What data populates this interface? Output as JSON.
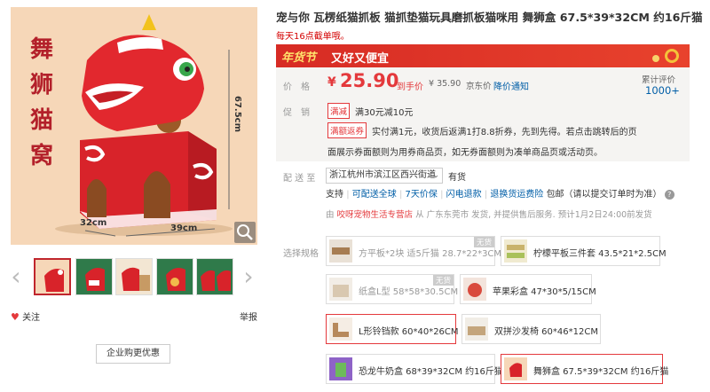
{
  "product": {
    "title": "宠与你 瓦楞纸猫抓板 猫抓垫猫玩具磨抓板猫咪用 舞狮盒 67.5*39*32CM 约16斤猫",
    "ship_note": "每天16点截单哦。"
  },
  "gallery": {
    "main_caption": "舞狮猫窝",
    "dim_height": "67.5cm",
    "dim_depth": "32cm",
    "dim_width": "39cm",
    "follow_label": "关注",
    "report_label": "举报",
    "corp_button": "企业购更优惠"
  },
  "banner": {
    "logo": "年货节",
    "slogan": "又好又便宜"
  },
  "price": {
    "label": "价　格",
    "currency": "¥",
    "value": "25.90",
    "suffix": "到手价",
    "jd_price": "¥ 35.90",
    "jd_label": "京东价",
    "notify": "降价通知",
    "review_label": "累计评价",
    "review_count": "1000+"
  },
  "promo": {
    "label": "促　销",
    "tag1": "满减",
    "text1": "满30元减10元",
    "tag2": "满额返券",
    "text2": "实付满1元，收货后返满1打8.8折券，先到先得。若点击跳转后的页",
    "text3": "面展示券面额则为用券商品页，如无券面额则为凑单商品页或活动页。"
  },
  "delivery": {
    "label": "配 送 至",
    "address": "浙江杭州市滨江区西兴街道",
    "stock": "有货",
    "support_label": "支持",
    "services": [
      "可配送全球",
      "7天价保",
      "闪电退款",
      "退换货运费险",
      "包邮（请以提交订单时为准）"
    ],
    "seller_prefix": "由",
    "seller": "咬呀宠物生活专营店",
    "seller_suffix": "从 广东东莞市 发货, 并提供售后服务. 预计1月2日24:00前发货"
  },
  "variants": {
    "label": "选择规格",
    "no_stock": "无货",
    "items": [
      {
        "name": "方平板*2块 适5斤猫 28.7*22*3CM",
        "sold_out": true,
        "selected": false
      },
      {
        "name": "柠檬平板三件套 43.5*21*2.5CM",
        "sold_out": false,
        "selected": false
      },
      {
        "name": "纸盒L型 58*58*30.5CM",
        "sold_out": true,
        "selected": false
      },
      {
        "name": "苹果彩盒 47*30*5/15CM",
        "sold_out": false,
        "selected": false
      },
      {
        "name": "L形铃铛款 60*40*26CM",
        "sold_out": false,
        "selected": false
      },
      {
        "name": "双拼沙发椅 60*46*12CM",
        "sold_out": false,
        "selected": false
      },
      {
        "name": "恐龙牛奶盒 68*39*32CM 约16斤猫",
        "sold_out": false,
        "selected": false
      },
      {
        "name": "舞狮盒 67.5*39*32CM 约16斤猫",
        "sold_out": false,
        "selected": true
      }
    ]
  },
  "colors": {
    "accent": "#e4393c",
    "link": "#005ea7",
    "banner": "#d72b24"
  }
}
